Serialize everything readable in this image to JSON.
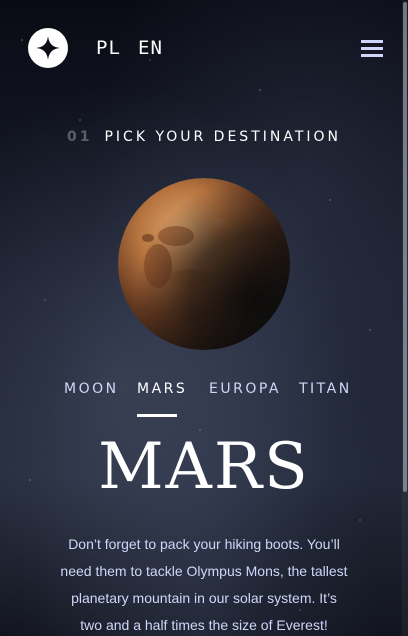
{
  "header": {
    "logo_icon": "star-logo-icon",
    "languages": [
      "PL",
      "EN"
    ],
    "menu_icon": "hamburger-menu-icon"
  },
  "page": {
    "heading_number": "01",
    "heading_text": "PICK YOUR DESTINATION"
  },
  "planet": {
    "image_icon": "mars-planet-image"
  },
  "tabs": [
    {
      "label": "MOON",
      "active": false
    },
    {
      "label": "MARS",
      "active": true
    },
    {
      "label": "EUROPA",
      "active": false
    },
    {
      "label": "TITAN",
      "active": false
    }
  ],
  "destination": {
    "name": "MARS",
    "description": "Don’t forget to pack your hiking boots. You’ll need them to tackle Olympus Mons, the tallest planetary mountain in our solar system. It’s two and a half times the size of Everest!"
  },
  "colors": {
    "background": "#0b0d17",
    "text_accent": "#d0d6f9",
    "white": "#ffffff"
  }
}
